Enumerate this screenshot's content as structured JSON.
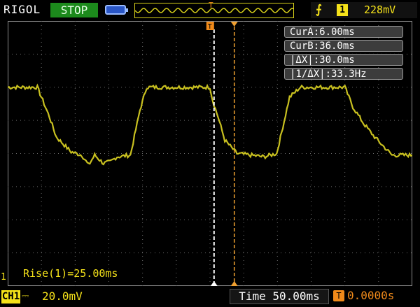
{
  "header": {
    "brand": "RIGOL",
    "run_state": "STOP",
    "trigger_position_marker": "T",
    "trigger_source_badge": "1",
    "trigger_level": "228mV",
    "colors": {
      "trace": "#c8c020",
      "cursor_a": "#ffffff",
      "cursor_b": "#f0a030",
      "run_state_bg": "#1c8a1c"
    }
  },
  "cursor_panel": {
    "cur_a": "CurA:6.00ms",
    "cur_b": "CurB:36.0ms",
    "delta_x": "|ΔX|:30.0ms",
    "inv_delta_x": "|1/ΔX|:33.3Hz"
  },
  "cursors": {
    "a_label": "T",
    "a_time_ms": 6.0,
    "b_time_ms": 36.0
  },
  "measurement": {
    "rise": "Rise(1)=25.00ms"
  },
  "footer": {
    "channel_label": "CH1",
    "channel_scale": "20.0mV",
    "timebase": "Time 50.00ms",
    "trigger_offset": "0.0000s",
    "ground_marker": "1"
  },
  "chart_data": {
    "type": "line",
    "divisions_x": 12,
    "divisions_y": 8,
    "time_per_div_ms": 50,
    "volts_per_div_mV": 20,
    "trigger_time_ms": 0,
    "xlim_ms": [
      -300,
      300
    ],
    "grid": true,
    "series": [
      {
        "points_t_ms": [
          -300,
          -256,
          -238,
          -228,
          -206,
          -190,
          -180,
          -171,
          -158,
          -148,
          -138,
          -118,
          -104,
          -94,
          0,
          4,
          12,
          22,
          40,
          60,
          80,
          99,
          108,
          118,
          134,
          200,
          212,
          228,
          244,
          258,
          270,
          300
        ],
        "points_v_div": [
          2.0,
          2.0,
          1.1,
          0.5,
          0.05,
          -0.05,
          -0.35,
          -0.05,
          -0.3,
          -0.25,
          -0.1,
          -0.05,
          1.3,
          2.0,
          2.0,
          1.6,
          1.1,
          0.4,
          0.0,
          -0.05,
          -0.1,
          0.0,
          0.8,
          1.7,
          2.0,
          2.0,
          1.4,
          0.9,
          0.5,
          0.2,
          -0.05,
          -0.05
        ]
      }
    ]
  }
}
